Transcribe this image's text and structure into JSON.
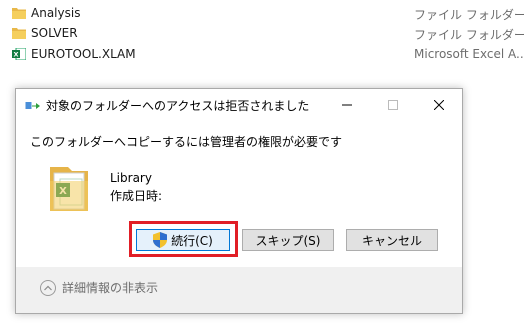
{
  "explorer": {
    "rows": [
      {
        "name": "Analysis",
        "type": "ファイル フォルダー",
        "icon": "folder-icon"
      },
      {
        "name": "SOLVER",
        "type": "ファイル フォルダー",
        "icon": "folder-icon"
      },
      {
        "name": "EUROTOOL.XLAM",
        "type": "Microsoft Excel A...",
        "icon": "excel-addin-icon"
      }
    ]
  },
  "dialog": {
    "title": "対象のフォルダーへのアクセスは拒否されました",
    "heading": "このフォルダーへコピーするには管理者の権限が必要です",
    "item": {
      "name": "Library",
      "date_label": "作成日時:"
    },
    "buttons": {
      "continue": "続行(C)",
      "skip": "スキップ(S)",
      "cancel": "キャンセル"
    },
    "details_toggle": "詳細情報の非表示",
    "highlight_color": "#e11e26",
    "accent_color": "#0078d7"
  }
}
